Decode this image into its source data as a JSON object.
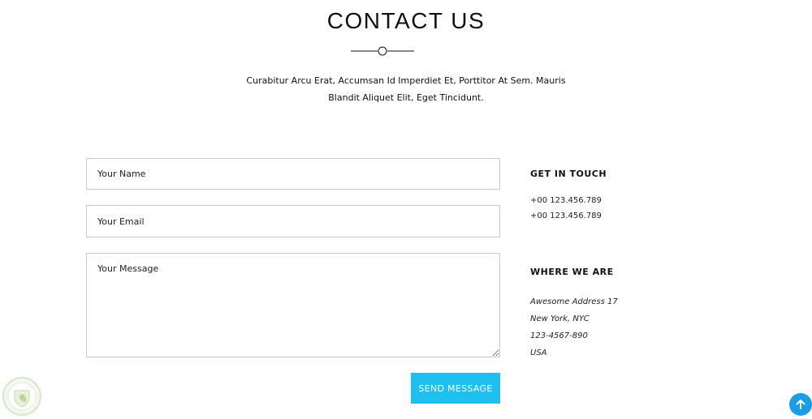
{
  "header": {
    "title": "CONTACT US",
    "intro_line1": "Curabitur Arcu Erat, Accumsan Id Imperdiet Et, Porttitor At Sem. Mauris",
    "intro_line2": "Blandit Aliquet Elit, Eget Tincidunt."
  },
  "form": {
    "name_placeholder": "Your Name",
    "email_placeholder": "Your Email",
    "message_placeholder": "Your Message",
    "send_label": "SEND MESSAGE"
  },
  "contact": {
    "touch_title": "GET IN TOUCH",
    "phones": [
      "+00 123.456.789",
      "+00 123.456.789"
    ],
    "where_title": "WHERE WE ARE",
    "address": [
      "Awesome Address 17",
      "New York, NYC",
      "123-4567-890",
      "USA"
    ]
  },
  "colors": {
    "accent": "#1ec0f0",
    "scroll_top": "#1a9ce6",
    "border": "#c9c9c9"
  },
  "icons": {
    "divider": "line-circle-divider-icon",
    "badge": "leaf-badge-icon",
    "scroll_top": "arrow-up-icon"
  }
}
